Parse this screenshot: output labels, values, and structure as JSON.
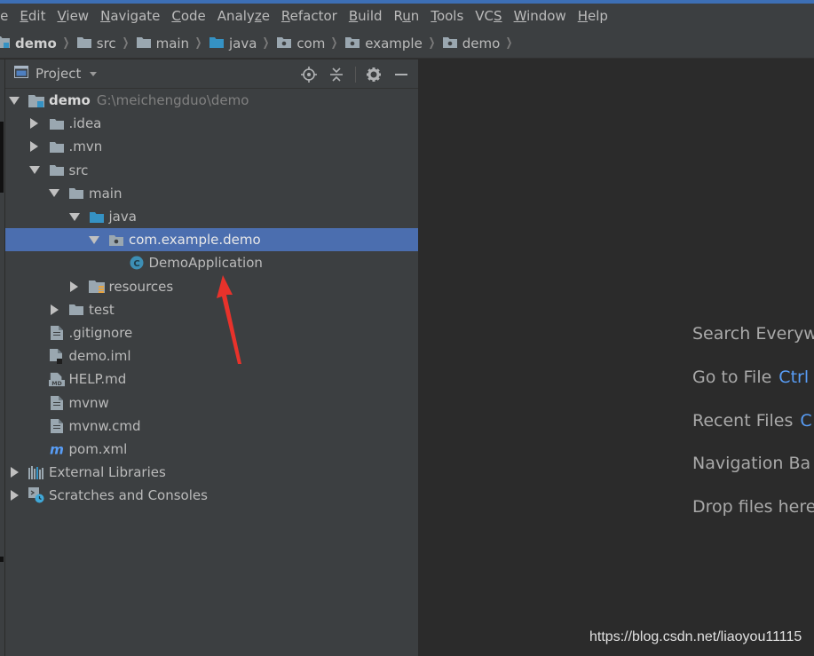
{
  "menu": {
    "items": [
      {
        "pre": "",
        "mn": "",
        "post": "le"
      },
      {
        "pre": "",
        "mn": "E",
        "post": "dit"
      },
      {
        "pre": "",
        "mn": "V",
        "post": "iew"
      },
      {
        "pre": "",
        "mn": "N",
        "post": "avigate"
      },
      {
        "pre": "",
        "mn": "C",
        "post": "ode"
      },
      {
        "pre": "Analy",
        "mn": "z",
        "post": "e"
      },
      {
        "pre": "",
        "mn": "R",
        "post": "efactor"
      },
      {
        "pre": "",
        "mn": "B",
        "post": "uild"
      },
      {
        "pre": "R",
        "mn": "u",
        "post": "n"
      },
      {
        "pre": "",
        "mn": "T",
        "post": "ools"
      },
      {
        "pre": "VC",
        "mn": "S",
        "post": ""
      },
      {
        "pre": "",
        "mn": "W",
        "post": "indow"
      },
      {
        "pre": "",
        "mn": "H",
        "post": "elp"
      }
    ]
  },
  "breadcrumb": [
    "demo",
    "src",
    "main",
    "java",
    "com",
    "example",
    "demo"
  ],
  "panel": {
    "title": "Project"
  },
  "tree": [
    {
      "label": "demo",
      "path": "G:\\meichengduo\\demo",
      "arrow": "down",
      "icon": "module-folder-icon",
      "indent": 0,
      "bold": true
    },
    {
      "label": ".idea",
      "arrow": "right",
      "icon": "folder-icon",
      "indent": 1
    },
    {
      "label": ".mvn",
      "arrow": "right",
      "icon": "folder-icon",
      "indent": 1
    },
    {
      "label": "src",
      "arrow": "down",
      "icon": "folder-icon",
      "indent": 1
    },
    {
      "label": "main",
      "arrow": "down",
      "icon": "folder-icon",
      "indent": 2
    },
    {
      "label": "java",
      "arrow": "down",
      "icon": "source-folder-icon",
      "indent": 3
    },
    {
      "label": "com.example.demo",
      "arrow": "down",
      "icon": "package-icon",
      "indent": 4,
      "selected": true
    },
    {
      "label": "DemoApplication",
      "arrow": "none",
      "icon": "class-icon",
      "indent": 5
    },
    {
      "label": "resources",
      "arrow": "right",
      "icon": "resources-folder-icon",
      "indent": 3
    },
    {
      "label": "test",
      "arrow": "right",
      "icon": "folder-icon",
      "indent": 2
    },
    {
      "label": ".gitignore",
      "arrow": "none",
      "icon": "file-icon",
      "indent": 1
    },
    {
      "label": "demo.iml",
      "arrow": "none",
      "icon": "iml-file-icon",
      "indent": 1
    },
    {
      "label": "HELP.md",
      "arrow": "none",
      "icon": "markdown-file-icon",
      "indent": 1
    },
    {
      "label": "mvnw",
      "arrow": "none",
      "icon": "file-icon",
      "indent": 1
    },
    {
      "label": "mvnw.cmd",
      "arrow": "none",
      "icon": "file-icon",
      "indent": 1
    },
    {
      "label": "pom.xml",
      "arrow": "none",
      "icon": "maven-icon",
      "indent": 1
    },
    {
      "label": "External Libraries",
      "arrow": "right",
      "icon": "libraries-icon",
      "indent": 0
    },
    {
      "label": "Scratches and Consoles",
      "arrow": "right",
      "icon": "scratches-icon",
      "indent": 0
    }
  ],
  "editor_hints": [
    {
      "text": "Search Everyw",
      "shortcut": ""
    },
    {
      "text": "Go to File",
      "shortcut": "Ctrl"
    },
    {
      "text": "Recent Files",
      "shortcut": "C"
    },
    {
      "text": "Navigation Ba",
      "shortcut": ""
    },
    {
      "text": "Drop files here",
      "shortcut": ""
    }
  ],
  "watermark": "https://blog.csdn.net/liaoyou11115",
  "colors": {
    "selection": "#4b6eaf",
    "panel_bg": "#3c3f41",
    "editor_bg": "#2b2b2b",
    "shortcut": "#589df6",
    "arrow_annotation": "#e8322b"
  }
}
